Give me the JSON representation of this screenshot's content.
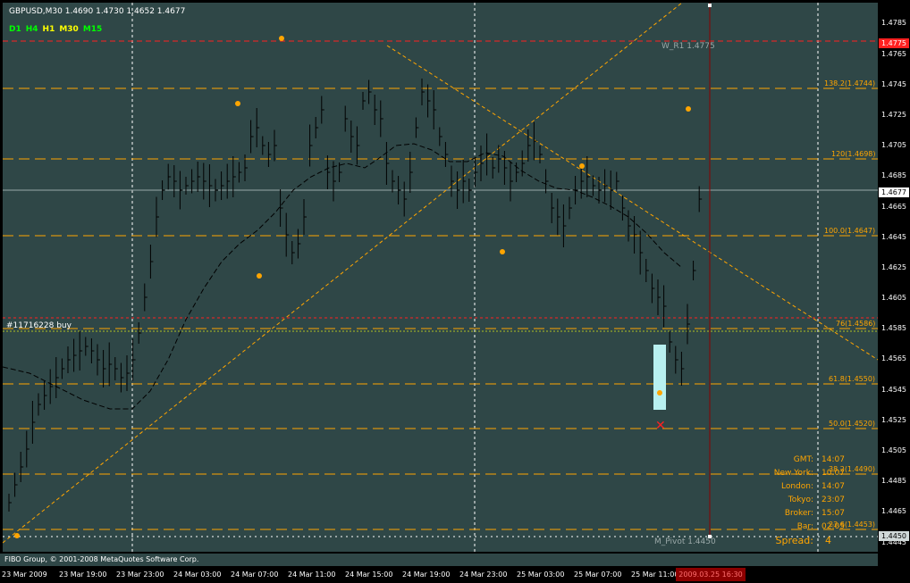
{
  "header": {
    "symbol_line": "GBPUSD,M30  1.4690 1.4730 1.4652 1.4677",
    "timeframes": [
      {
        "label": "D1",
        "color": "#00ff00"
      },
      {
        "label": "H4",
        "color": "#00ff00"
      },
      {
        "label": "H1",
        "color": "#ffff00"
      },
      {
        "label": "M30",
        "color": "#ffff00"
      },
      {
        "label": "M15",
        "color": "#00ff00"
      }
    ]
  },
  "order_label": "#11716228 buy",
  "pivot_labels": {
    "w_r1": "W_R1 1.4775",
    "m_pivot": "M_Pivot 1.4450"
  },
  "fib_labels": [
    "138.2(1.4744)",
    "120(1.4698)",
    "100.0(1.4647)",
    "76(1.4586)",
    "61.8(1.4550)",
    "50.0(1.4520)",
    "38.2(1.4490)",
    "23.6(1.4453)"
  ],
  "info_panel": {
    "rows": [
      {
        "label": "GMT:",
        "value": "14:07"
      },
      {
        "label": "New York:",
        "value": "10:07"
      },
      {
        "label": "London:",
        "value": "14:07"
      },
      {
        "label": "Tokyo:",
        "value": "23:07"
      },
      {
        "label": "Broker:",
        "value": "15:07"
      },
      {
        "label": "Bar:",
        "value": "02:05"
      }
    ],
    "spread_label": "Spread:",
    "spread_value": "4"
  },
  "copyright": "FIBO Group, © 2001-2008 MetaQuotes Software Corp.",
  "price_axis": {
    "ticks": [
      "1.4785",
      "1.4765",
      "1.4745",
      "1.4725",
      "1.4705",
      "1.4685",
      "1.4665",
      "1.4645",
      "1.4625",
      "1.4605",
      "1.4585",
      "1.4565",
      "1.4545",
      "1.4525",
      "1.4505",
      "1.4485",
      "1.4465",
      "1.4445"
    ],
    "current_price": "1.4677",
    "red_tag": "1.4775",
    "pivot_tag": "1.4450"
  },
  "time_axis": {
    "ticks": [
      "23 Mar 2009",
      "23 Mar 19:00",
      "23 Mar 23:00",
      "24 Mar 03:00",
      "24 Mar 07:00",
      "24 Mar 11:00",
      "24 Mar 15:00",
      "24 Mar 19:00",
      "24 Mar 23:00",
      "25 Mar 03:00",
      "25 Mar 07:00",
      "25 Mar 11:00"
    ],
    "cursor_time": "2009.03.25 16:30"
  },
  "colors": {
    "background": "#2f4747",
    "bars": "#000000",
    "fib_lines": "#ffa500",
    "red_lines": "#ff2020",
    "period_separators": "#ffffff",
    "text_accent": "#ffa500"
  }
}
